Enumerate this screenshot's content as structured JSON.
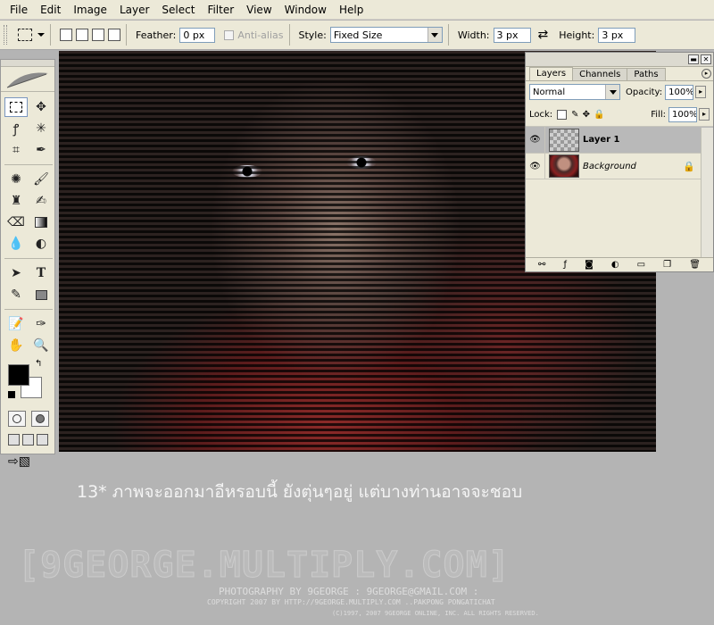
{
  "menu": [
    "File",
    "Edit",
    "Image",
    "Layer",
    "Select",
    "Filter",
    "View",
    "Window",
    "Help"
  ],
  "options": {
    "feather_label": "Feather:",
    "feather_value": "0 px",
    "antialias_label": "Anti-alias",
    "style_label": "Style:",
    "style_value": "Fixed Size",
    "width_label": "Width:",
    "width_value": "3 px",
    "height_label": "Height:",
    "height_value": "3 px"
  },
  "colors": {
    "foreground": "#000000",
    "background": "#ffffff"
  },
  "layers_panel": {
    "tabs": [
      "Layers",
      "Channels",
      "Paths"
    ],
    "blend_mode": "Normal",
    "opacity_label": "Opacity:",
    "opacity_value": "100%",
    "lock_label": "Lock:",
    "fill_label": "Fill:",
    "fill_value": "100%",
    "layers": [
      {
        "name": "Layer 1",
        "selected": true
      },
      {
        "name": "Background",
        "selected": false
      }
    ]
  },
  "caption": "13* ภาพจะออกมาอีหรอบนี้ ยังตุ่นๆอยู่ แต่บางท่านอาจจะชอบ",
  "watermark": {
    "main": "[9GEORGE.MULTIPLY.COM]",
    "line1": "PHOTOGRAPHY BY 9GEORGE : 9GEORGE@GMAIL.COM :",
    "line2": "COPYRIGHT 2007 BY HTTP://9GEORGE.MULTIPLY.COM ..PAKPONG PONGATICHAT",
    "line3": "(C)1997, 2007 9GEORGE ONLINE, INC. ALL RIGHTS RESERVED."
  }
}
